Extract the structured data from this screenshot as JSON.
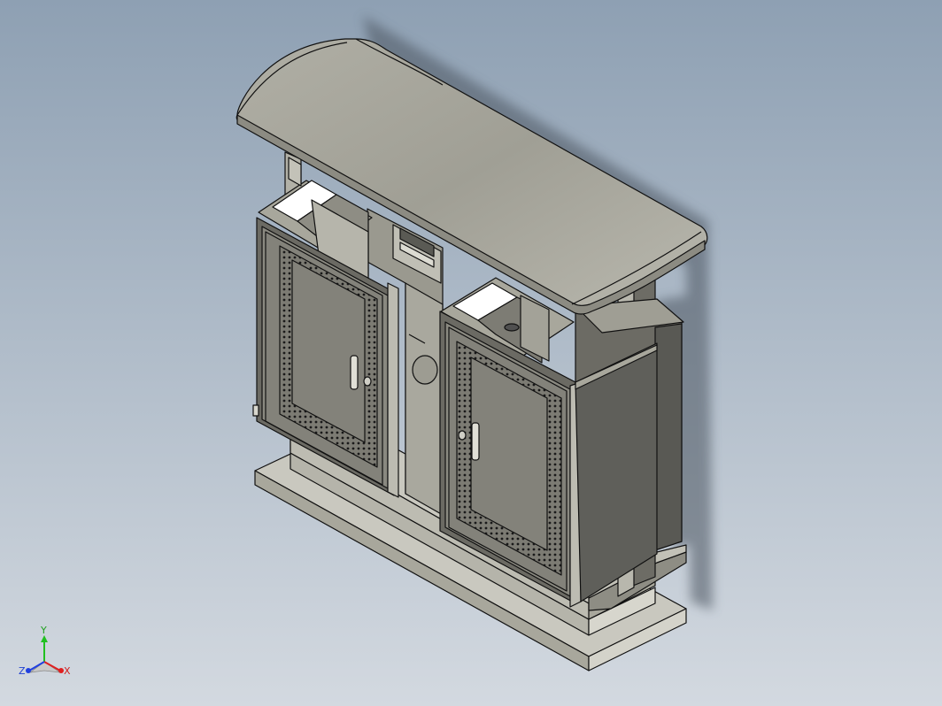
{
  "viewport": {
    "background_top": "#8ea0b3",
    "background_bottom": "#d3d9e0"
  },
  "model": {
    "body_color": "#a8a79c",
    "dark_face_color": "#5f5f5a",
    "light_face_color": "#c9c8bf",
    "edge_color": "#111111",
    "opening_color": "#ffffff"
  },
  "triad": {
    "x_label": "X",
    "y_label": "Y",
    "z_label": "Z",
    "x_color": "#e02020",
    "y_color": "#20c020",
    "z_color": "#2040e0"
  }
}
